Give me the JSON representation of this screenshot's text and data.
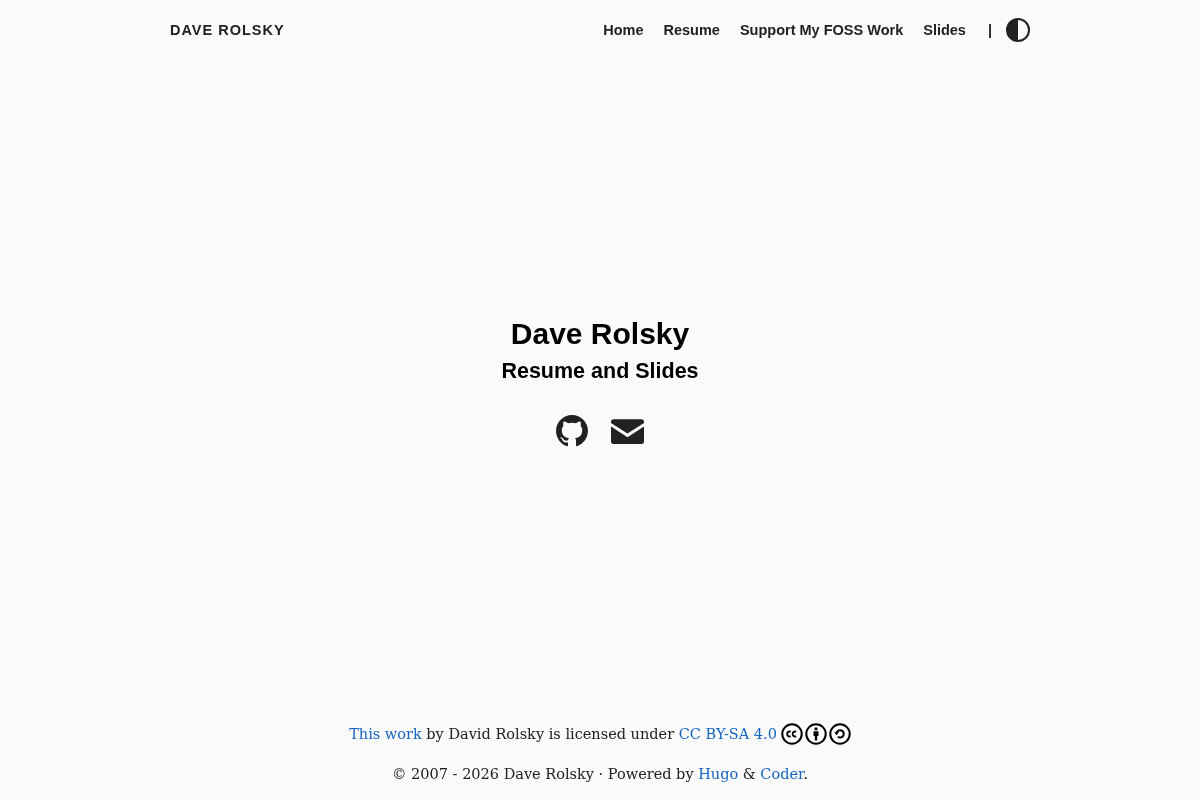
{
  "header": {
    "site_title": "DAVE ROLSKY",
    "nav": [
      {
        "label": "Home"
      },
      {
        "label": "Resume"
      },
      {
        "label": "Support My FOSS Work"
      },
      {
        "label": "Slides"
      }
    ],
    "separator": "|"
  },
  "hero": {
    "name": "Dave Rolsky",
    "tagline": "Resume and Slides"
  },
  "footer": {
    "license": [
      {
        "kind": "link",
        "text": "This work"
      },
      {
        "kind": "text",
        "text": " by David Rolsky is licensed under "
      },
      {
        "kind": "link",
        "text": "CC BY-SA 4.0"
      }
    ],
    "credits": [
      {
        "kind": "text",
        "text": "© 2007 - 2026 Dave Rolsky · Powered by "
      },
      {
        "kind": "link",
        "text": "Hugo"
      },
      {
        "kind": "text",
        "text": " & "
      },
      {
        "kind": "link",
        "text": "Coder"
      },
      {
        "kind": "text",
        "text": "."
      }
    ]
  }
}
